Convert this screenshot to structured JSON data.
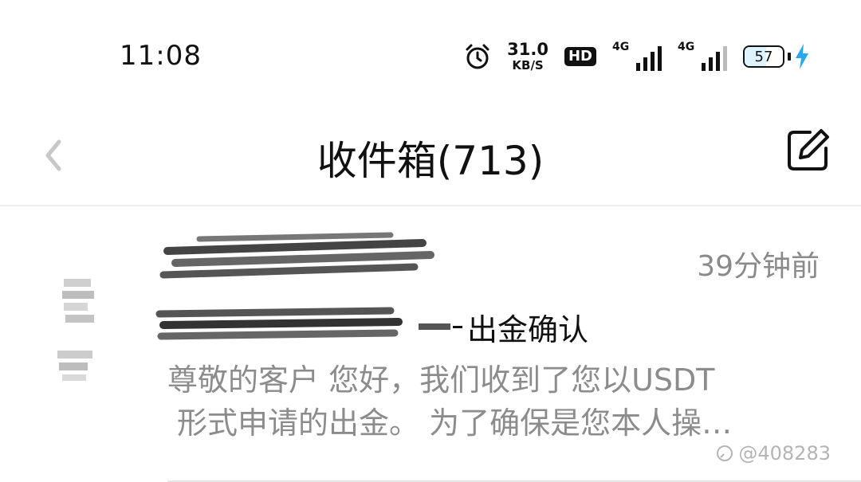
{
  "status_bar": {
    "time": "11:08",
    "net_speed_value": "31.0",
    "net_speed_unit": "KB/S",
    "hd_label": "HD",
    "signal1_label": "4G",
    "signal2_label": "4G",
    "battery_level": "57",
    "battery_fraction": 0.57,
    "charging_color": "#29a8f0"
  },
  "header": {
    "title": "收件箱(713)",
    "back_icon": "chevron-left-icon",
    "compose_icon": "compose-icon"
  },
  "mail_items": [
    {
      "time_ago": "39分钟前",
      "subject": "出金确认",
      "preview_line1": "尊敬的客户 您好，我们收到了您以USDT",
      "preview_line2": "形式申请的出金。 为了确保是您本人操…"
    }
  ],
  "watermark": "@408283"
}
